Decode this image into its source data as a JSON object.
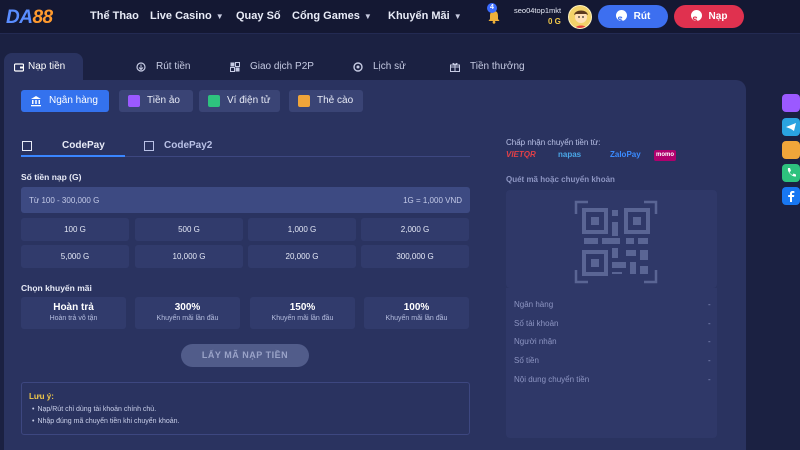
{
  "header": {
    "logo_main": "DA",
    "logo_num": "88",
    "nav": [
      {
        "label": "Thể Thao",
        "dropdown": false
      },
      {
        "label": "Live Casino",
        "dropdown": true
      },
      {
        "label": "Quay Số",
        "dropdown": false
      },
      {
        "label": "Cổng Games",
        "dropdown": true
      },
      {
        "label": "Khuyến Mãi",
        "dropdown": true
      }
    ],
    "notification_count": "4",
    "username": "seo04top1mkt",
    "balance": "0 G",
    "withdraw_label": "Rút",
    "deposit_label": "Nạp"
  },
  "tabs": [
    {
      "label": "Nạp tiền",
      "icon": "wallet-icon"
    },
    {
      "label": "Rút tiền",
      "icon": "withdraw-icon"
    },
    {
      "label": "Giao dịch P2P",
      "icon": "p2p-icon"
    },
    {
      "label": "Lịch sử",
      "icon": "history-icon"
    },
    {
      "label": "Tiền thưởng",
      "icon": "gift-icon"
    }
  ],
  "methods": [
    {
      "label": "Ngân hàng",
      "icon": "bank-icon",
      "color": "#ffffff"
    },
    {
      "label": "Tiền ảo",
      "icon": "crypto-icon",
      "color": "#9b59ff"
    },
    {
      "label": "Ví điện tử",
      "icon": "ewallet-icon",
      "color": "#2ec27e"
    },
    {
      "label": "Thẻ cào",
      "icon": "card-icon",
      "color": "#f0a53a"
    }
  ],
  "sub_tabs": [
    "CodePay",
    "CodePay2"
  ],
  "form": {
    "amount_label": "Số tiền nạp (G)",
    "amount_placeholder": "Từ 100 - 300,000 G",
    "rate": "1G = 1,000 VND",
    "amounts": [
      "100 G",
      "500 G",
      "1,000 G",
      "2,000 G",
      "5,000 G",
      "10,000 G",
      "20,000 G",
      "300,000 G"
    ],
    "promo_label": "Chọn khuyến mãi",
    "promos": [
      {
        "title": "Hoàn trả",
        "sub": "Hoàn trả vô tận"
      },
      {
        "title": "300%",
        "sub": "Khuyến mãi lần đầu"
      },
      {
        "title": "150%",
        "sub": "Khuyến mãi lần đầu"
      },
      {
        "title": "100%",
        "sub": "Khuyến mãi lần đầu"
      }
    ],
    "submit_label": "LẤY MÃ NẠP TIỀN"
  },
  "note": {
    "title": "Lưu ý:",
    "lines": [
      "Nạp/Rút chỉ dùng tài khoản chính chủ.",
      "Nhập đúng mã chuyển tiền khi chuyển khoản."
    ]
  },
  "right": {
    "accept_label": "Chấp nhận chuyển tiền từ:",
    "partners": [
      "VIETQR",
      "napas",
      "ZaloPay",
      "momo"
    ],
    "scan_label": "Quét mã hoặc chuyển khoản",
    "info": [
      {
        "label": "Ngân hàng",
        "value": "-"
      },
      {
        "label": "Số tài khoản",
        "value": "-"
      },
      {
        "label": "Người nhận",
        "value": "-"
      },
      {
        "label": "Số tiền",
        "value": "-"
      },
      {
        "label": "Nội dung chuyển tiền",
        "value": "-"
      }
    ]
  },
  "side_icons": [
    "chat-icon",
    "telegram-icon",
    "group-icon",
    "phone-icon",
    "facebook-icon"
  ]
}
